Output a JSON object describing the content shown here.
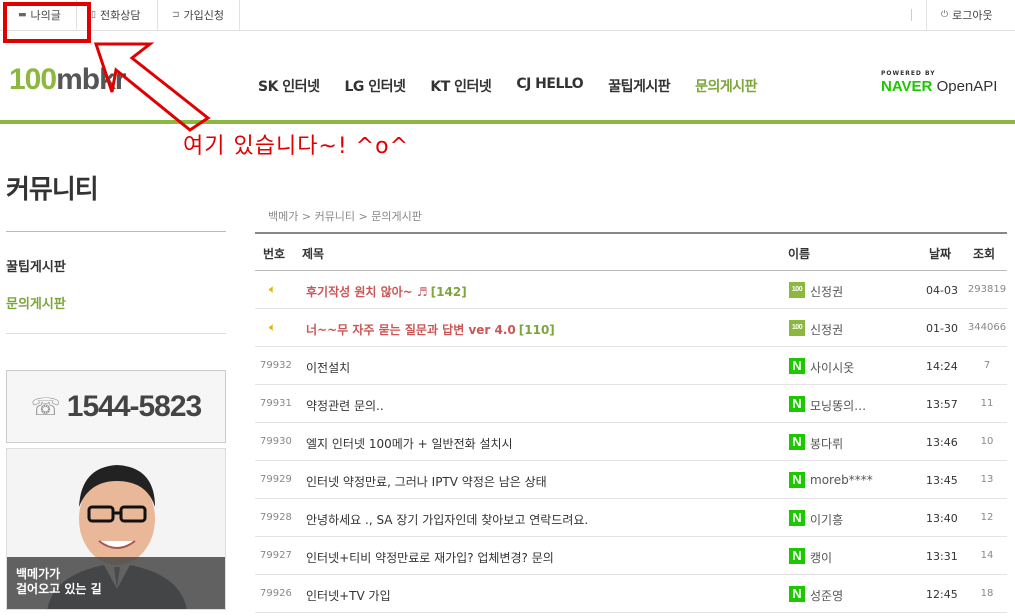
{
  "topbar": {
    "my_posts": "나의글",
    "phone_consult": "전화상담",
    "join_request": "가입신청",
    "logout": "로그아웃"
  },
  "header": {
    "logo_num": "100",
    "logo_rest": "mbkr",
    "nav": [
      "SK 인터넷",
      "LG 인터넷",
      "KT 인터넷",
      "CJ HELLO",
      "꿀팁게시판",
      "문의게시판"
    ],
    "active_nav": "문의게시판",
    "powered_by": "POWERED BY",
    "naver": "NAVER",
    "openapi": "OpenAPI"
  },
  "annotation": {
    "text": "여기 있습니다~! ^o^"
  },
  "sidebar": {
    "title": "커뮤니티",
    "links": [
      "꿀팁게시판",
      "문의게시판"
    ],
    "phone": "1544-5823",
    "promo_line1": "백메가가",
    "promo_line2": "걸어오고 있는 길"
  },
  "breadcrumb": "백메가 > 커뮤니티 > 문의게시판",
  "board": {
    "headers": {
      "no": "번호",
      "title": "제목",
      "name": "이름",
      "date": "날짜",
      "views": "조회"
    },
    "rows": [
      {
        "no": "",
        "notice": true,
        "title": "후기작성 원치 않아~ ♬",
        "comments": "[142]",
        "badge": "100",
        "name": "신정권",
        "date": "04-03",
        "views": "293819"
      },
      {
        "no": "",
        "notice": true,
        "title": "너~~무 자주 묻는 질문과 답변 ver 4.0",
        "comments": "[110]",
        "badge": "100",
        "name": "신정권",
        "date": "01-30",
        "views": "344066"
      },
      {
        "no": "79932",
        "notice": false,
        "title": "이전설치",
        "comments": "",
        "badge": "N",
        "name": "사이시옷",
        "date": "14:24",
        "views": "7"
      },
      {
        "no": "79931",
        "notice": false,
        "title": "약정관련 문의..",
        "comments": "",
        "badge": "N",
        "name": "모닝똥의…",
        "date": "13:57",
        "views": "11"
      },
      {
        "no": "79930",
        "notice": false,
        "title": "엘지 인터넷 100메가 + 일반전화 설치시",
        "comments": "",
        "badge": "N",
        "name": "봉다뤼",
        "date": "13:46",
        "views": "10"
      },
      {
        "no": "79929",
        "notice": false,
        "title": "인터넷 약정만료, 그러나 IPTV 약정은 남은 상태",
        "comments": "",
        "badge": "N",
        "name": "moreb****",
        "date": "13:45",
        "views": "13"
      },
      {
        "no": "79928",
        "notice": false,
        "title": "안녕하세요 ., SA 장기 가입자인데 찾아보고 연락드려요.",
        "comments": "",
        "badge": "N",
        "name": "이기흥",
        "date": "13:40",
        "views": "12"
      },
      {
        "no": "79927",
        "notice": false,
        "title": "인터넷+티비 약정만료로 재가입? 업체변경? 문의",
        "comments": "",
        "badge": "N",
        "name": "캥이",
        "date": "13:31",
        "views": "14"
      },
      {
        "no": "79926",
        "notice": false,
        "title": "인터넷+TV 가입",
        "comments": "",
        "badge": "N",
        "name": "성준영",
        "date": "12:45",
        "views": "18"
      }
    ]
  }
}
